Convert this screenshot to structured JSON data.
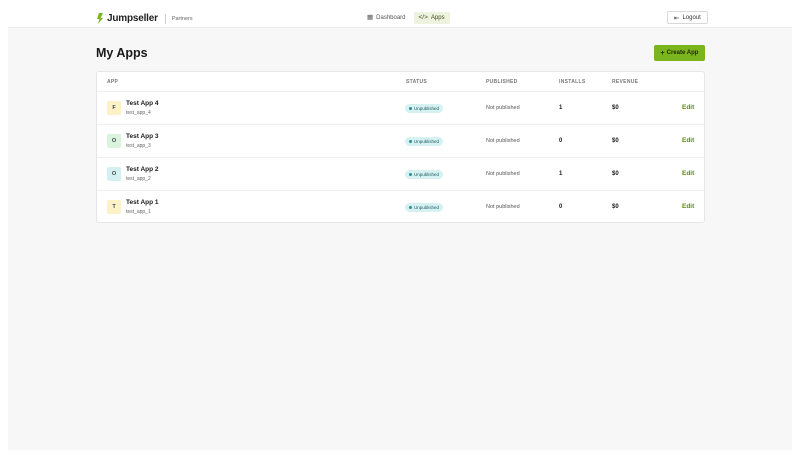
{
  "header": {
    "brand": "Jumpseller",
    "brand_sub": "Partners",
    "nav": [
      {
        "label": "Dashboard",
        "icon": "grid-icon",
        "active": false
      },
      {
        "label": "Apps",
        "icon": "code-icon",
        "active": true
      }
    ],
    "logout_label": "Logout",
    "colors": {
      "brand": "#7ab51d"
    }
  },
  "page": {
    "title": "My Apps",
    "create_label": "Create App"
  },
  "table": {
    "columns": [
      "APP",
      "STATUS",
      "PUBLISHED",
      "INSTALLS",
      "REVENUE"
    ],
    "rows": [
      {
        "initial": "F",
        "avatar_color": "#fdf1c7",
        "name": "Test App 4",
        "slug": "test_app_4",
        "status": "Unpublished",
        "published": "Not published",
        "installs": "1",
        "revenue": "$0",
        "action": "Edit"
      },
      {
        "initial": "O",
        "avatar_color": "#d9f3dc",
        "name": "Test App 3",
        "slug": "test_app_3",
        "status": "Unpublished",
        "published": "Not published",
        "installs": "0",
        "revenue": "$0",
        "action": "Edit"
      },
      {
        "initial": "O",
        "avatar_color": "#d3f0f3",
        "name": "Test App 2",
        "slug": "test_app_2",
        "status": "Unpublished",
        "published": "Not published",
        "installs": "1",
        "revenue": "$0",
        "action": "Edit"
      },
      {
        "initial": "T",
        "avatar_color": "#fdf1c7",
        "name": "Test App 1",
        "slug": "test_app_1",
        "status": "Unpublished",
        "published": "Not published",
        "installs": "0",
        "revenue": "$0",
        "action": "Edit"
      }
    ]
  }
}
